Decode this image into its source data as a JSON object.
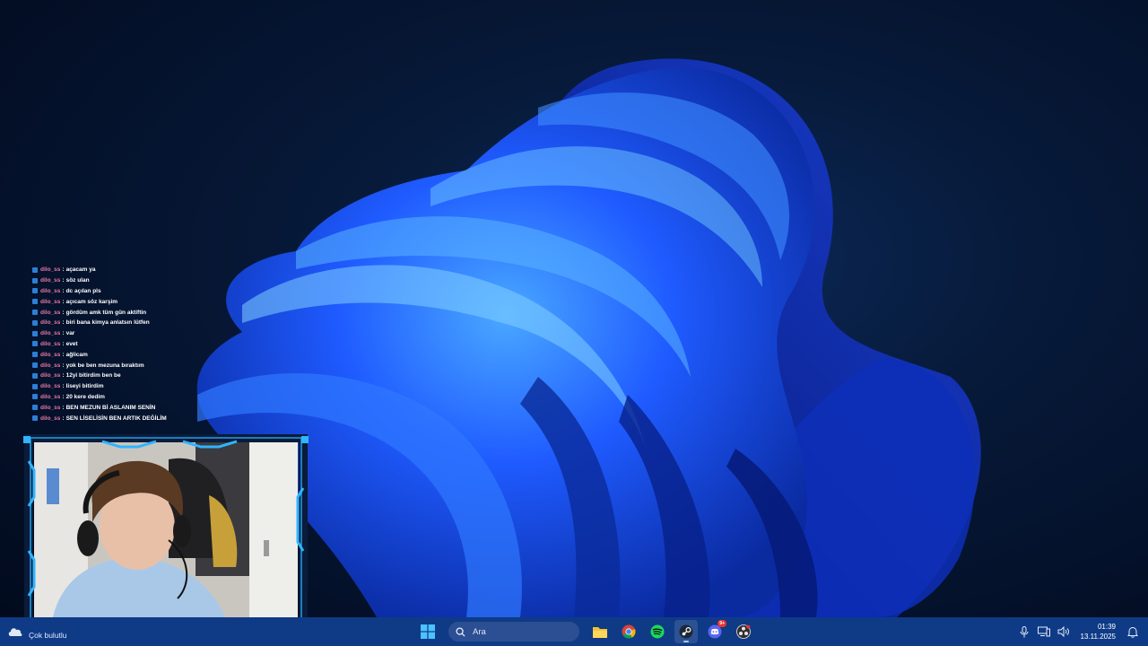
{
  "chat": {
    "messages": [
      {
        "user": "dilo_ss",
        "text": "açacam ya"
      },
      {
        "user": "dilo_ss",
        "text": "söz ulan"
      },
      {
        "user": "dilo_ss",
        "text": "dc açılan pls"
      },
      {
        "user": "dilo_ss",
        "text": "açıcam söz karşim"
      },
      {
        "user": "dilo_ss",
        "text": "gördüm amk tüm gün aktiftin"
      },
      {
        "user": "dilo_ss",
        "text": "biri bana kimya anlatsın lütfen"
      },
      {
        "user": "dilo_ss",
        "text": "var"
      },
      {
        "user": "dilo_ss",
        "text": "evet"
      },
      {
        "user": "dilo_ss",
        "text": "ağlicam"
      },
      {
        "user": "dilo_ss",
        "text": "yok be ben mezuna bıraktım"
      },
      {
        "user": "dilo_ss",
        "text": "12yi bitirdim ben be"
      },
      {
        "user": "dilo_ss",
        "text": "liseyi bitirdim"
      },
      {
        "user": "dilo_ss",
        "text": "20 kere dedim"
      },
      {
        "user": "dilo_ss",
        "text": "BEN MEZUN Bİ ASLANIM SENİN"
      },
      {
        "user": "dilo_ss",
        "text": "SEN LİSELİSİN BEN ARTIK DEĞİLİM"
      }
    ],
    "separator": ":"
  },
  "taskbar": {
    "weather_label": "Çok bulutlu",
    "search_placeholder": "Ara",
    "discord_badge": "9+",
    "time": "01:39",
    "date": "13.11.2025"
  },
  "colors": {
    "taskbar_bg": "#0f3b86",
    "username": "#e87aa8",
    "wallpaper_accent": "#1f5bff"
  }
}
